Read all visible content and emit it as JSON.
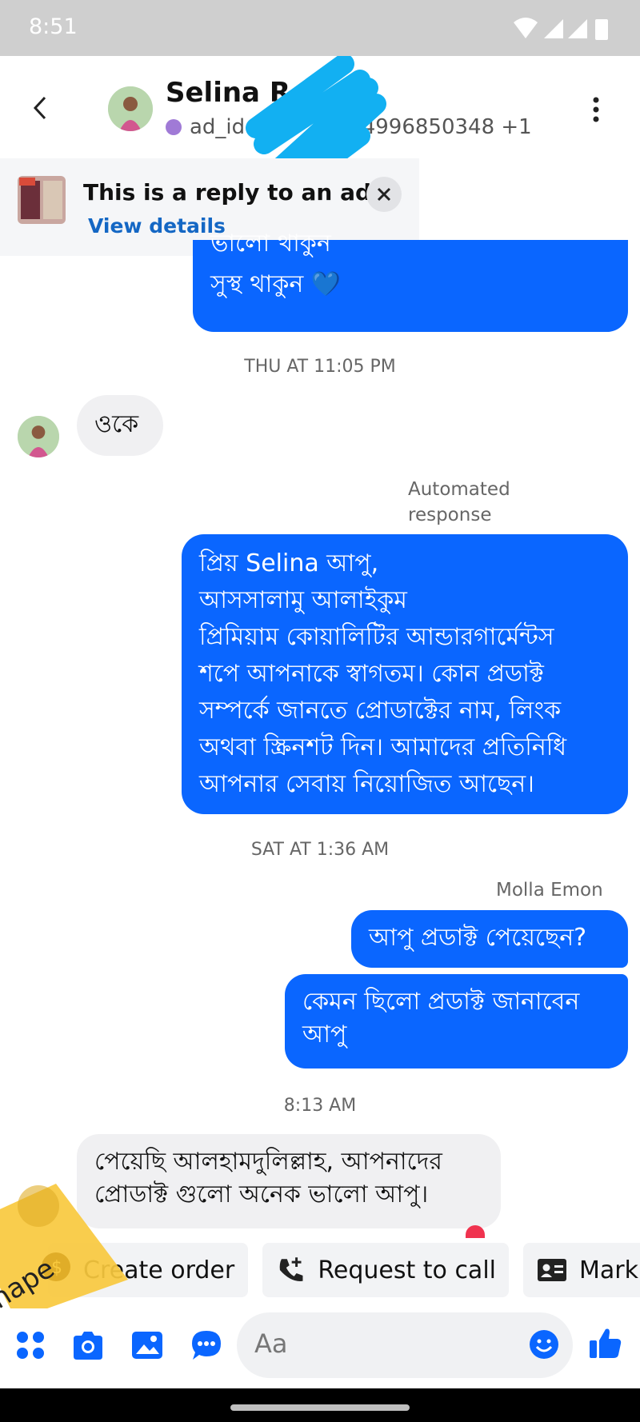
{
  "status_bar": {
    "time": "8:51"
  },
  "header": {
    "contact_name": "Selina R",
    "ad_id": "ad_id",
    "ad_id_tail": "04996850348 +1"
  },
  "ad_banner": {
    "title": "This is a reply to an ad",
    "link": "View details"
  },
  "messages": {
    "m1_line1": "ভালো থাকুন",
    "m1_line2": "সুস্থ থাকুন 💙",
    "stamp1": "THU AT 11:05 PM",
    "m2": "ওকে",
    "automated_label_1": "Automated",
    "automated_label_2": "response",
    "m3_lines": [
      "প্রিয় Selina আপু,",
      "আসসালামু আলাইকুম",
      "প্রিমিয়াম কোয়ালিটির আন্ডারগার্মেন্টস",
      "শপে আপনাকে স্বাগতম। কোন প্রডাক্ট",
      "সম্পর্কে জানতে প্রোডাক্টের নাম, লিংক",
      "অথবা স্ক্রিনশট দিন। আমাদের প্রতিনিধি",
      "আপনার সেবায় নিয়োজিত আছেন।"
    ],
    "stamp2": "SAT AT 1:36 AM",
    "sender2": "Molla Emon",
    "m4": "আপু প্রডাক্ট পেয়েছেন?",
    "m5_line1": "কেমন ছিলো প্রডাক্ট জানাবেন",
    "m5_line2": "আপু",
    "stamp3": "8:13 AM",
    "m6_line1": "পেয়েছি আলহামদুলিল্লাহ, আপনাদের",
    "m6_line2": "প্রোডাক্ট গুলো অনেক ভালো আপু।"
  },
  "quick_replies": {
    "create_order": "Create order",
    "request_call": "Request to call",
    "mark": "Mark"
  },
  "composer": {
    "placeholder": "Aa"
  },
  "sticker": {
    "text": "hape"
  },
  "colors": {
    "accent": "#0a66ff",
    "link": "#1467c4",
    "incoming_bubble": "#f0f0f2",
    "status_bar": "#cfcfcf"
  }
}
